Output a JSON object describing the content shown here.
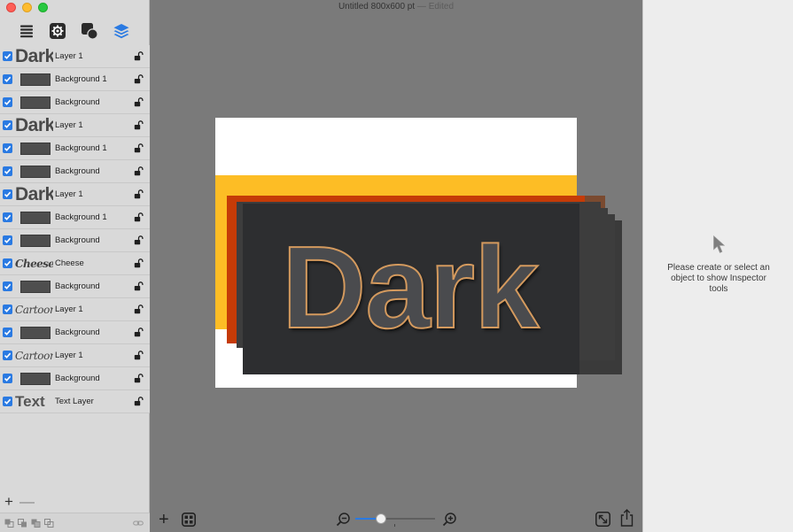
{
  "window": {
    "title": "Untitled 800x600 pt",
    "separator": "—",
    "edited": "Edited"
  },
  "sidebar": {
    "tabs": [
      {
        "name": "list",
        "icon": "list-icon"
      },
      {
        "name": "settings",
        "icon": "gear-icon"
      },
      {
        "name": "shapes",
        "icon": "shapes-icon"
      },
      {
        "name": "layers",
        "icon": "layers-icon",
        "active": true
      }
    ],
    "layers": [
      {
        "thumb_type": "text",
        "thumb_text": "Dark",
        "thumb_style": "dark",
        "label": "Layer 1",
        "checked": true
      },
      {
        "thumb_type": "rect",
        "label": "Background 1",
        "checked": true
      },
      {
        "thumb_type": "rect",
        "label": "Background",
        "checked": true
      },
      {
        "thumb_type": "text",
        "thumb_text": "Dark",
        "thumb_style": "dark",
        "label": "Layer 1",
        "checked": true
      },
      {
        "thumb_type": "rect",
        "label": "Background 1",
        "checked": true
      },
      {
        "thumb_type": "rect",
        "label": "Background",
        "checked": true
      },
      {
        "thumb_type": "text",
        "thumb_text": "Dark",
        "thumb_style": "dark",
        "label": "Layer 1",
        "checked": true
      },
      {
        "thumb_type": "rect",
        "label": "Background 1",
        "checked": true
      },
      {
        "thumb_type": "rect",
        "label": "Background",
        "checked": true
      },
      {
        "thumb_type": "text",
        "thumb_text": "Cheese",
        "thumb_style": "cheese",
        "label": "Cheese",
        "checked": true
      },
      {
        "thumb_type": "rect",
        "label": "Background",
        "checked": true
      },
      {
        "thumb_type": "text",
        "thumb_text": "Cartoon",
        "thumb_style": "cartoon",
        "label": "Layer 1",
        "checked": true
      },
      {
        "thumb_type": "rect",
        "label": "Background",
        "checked": true
      },
      {
        "thumb_type": "text",
        "thumb_text": "Cartoon",
        "thumb_style": "cartoon",
        "label": "Layer 1",
        "checked": true
      },
      {
        "thumb_type": "rect",
        "label": "Background",
        "checked": true
      },
      {
        "thumb_type": "text",
        "thumb_text": "Text",
        "thumb_style": "text",
        "label": "Text Layer",
        "checked": true
      }
    ],
    "footer": {
      "add": "+",
      "remove": "—"
    }
  },
  "canvas": {
    "artwork_text": "Dark",
    "colors": {
      "yellow": "#fdbd25",
      "orange": "#c53b07",
      "card": "#2d2e30",
      "outline": "#d49a5e",
      "accent": "#2a7ae2"
    },
    "zoom_level": 0.32,
    "zoom_tick": "1"
  },
  "inspector": {
    "message": "Please create or select an object to show Inspector tools"
  }
}
